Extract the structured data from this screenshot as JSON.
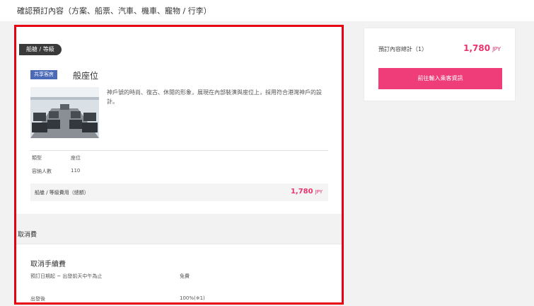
{
  "header": {
    "title": "確認預訂內容（方案、船票、汽車、機車、寵物 / 行李）"
  },
  "booking": {
    "section_tag": "船艙 / 等級",
    "type_badge": "共享客房",
    "type_name": "般座位",
    "description": "神戶號的時尚、復古、休閒的形象，展現在內部裝潢與座位上，採用符合港灣神戶的設計。",
    "details": [
      {
        "label": "類型",
        "value": "座位"
      },
      {
        "label": "容納人數",
        "value": "110"
      }
    ],
    "fare": {
      "label": "船艙 / 等級費用（總額）",
      "amount": "1,780",
      "currency": "JPY"
    }
  },
  "cancellation": {
    "title": "取消費",
    "fee_heading": "取消手續費",
    "rows": [
      {
        "label": "預訂日期起 ~ 出發前天中午為止",
        "value": "免費"
      },
      {
        "label": "出發後",
        "value": "100%(※1)"
      }
    ]
  },
  "summary": {
    "total_label": "預訂內容總計（1）",
    "total_amount": "1,780",
    "currency": "JPY",
    "cta_label": "前往輸入乘客資訊"
  },
  "colors": {
    "accent": "#ee3d79",
    "price": "#e8336d",
    "badge": "#4a6ab8",
    "highlight_border": "#e60012"
  }
}
